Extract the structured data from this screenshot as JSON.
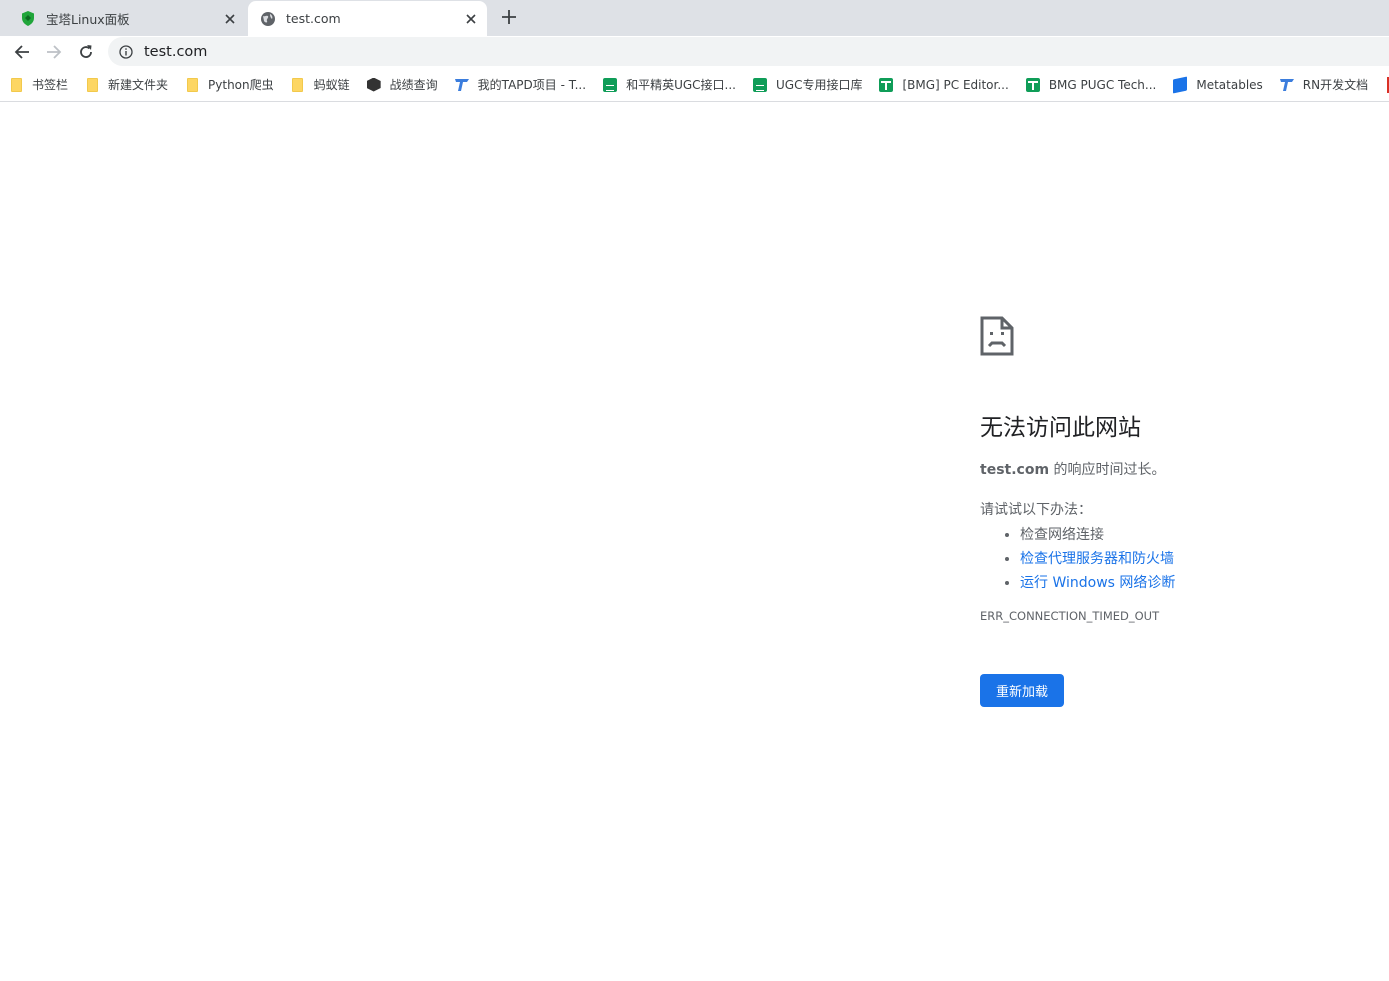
{
  "tabs": [
    {
      "title": "宝塔Linux面板",
      "icon": "baota-shield-icon",
      "active": false
    },
    {
      "title": "test.com",
      "icon": "globe-icon",
      "active": true
    }
  ],
  "toolbar": {
    "url": "test.com"
  },
  "bookmarks": [
    {
      "label": "书签栏",
      "icon": "folder-icon"
    },
    {
      "label": "新建文件夹",
      "icon": "folder-icon"
    },
    {
      "label": "Python爬虫",
      "icon": "folder-icon"
    },
    {
      "label": "蚂蚁链",
      "icon": "folder-icon"
    },
    {
      "label": "战绩查询",
      "icon": "hexagon-icon"
    },
    {
      "label": "我的TAPD项目 - T...",
      "icon": "tapd-icon"
    },
    {
      "label": "和平精英UGC接口...",
      "icon": "sheets-icon"
    },
    {
      "label": "UGC专用接口库",
      "icon": "sheets-icon"
    },
    {
      "label": "[BMG] PC Editor...",
      "icon": "table-icon"
    },
    {
      "label": "BMG PUGC Tech...",
      "icon": "table-icon"
    },
    {
      "label": "Metatables",
      "icon": "metatables-icon"
    },
    {
      "label": "RN开发文档",
      "icon": "tapd-icon"
    }
  ],
  "error": {
    "heading": "无法访问此网站",
    "host": "test.com",
    "description_suffix": " 的响应时间过长。",
    "try_label": "请试试以下办法：",
    "suggestions": [
      {
        "text": "检查网络连接",
        "link": false
      },
      {
        "text": "检查代理服务器和防火墙",
        "link": true
      },
      {
        "text": "运行 Windows 网络诊断",
        "link": true
      }
    ],
    "code": "ERR_CONNECTION_TIMED_OUT",
    "reload_label": "重新加载"
  },
  "colors": {
    "accent": "#1a73e8",
    "tabstrip": "#dee1e6",
    "omnibox": "#f1f3f4"
  }
}
